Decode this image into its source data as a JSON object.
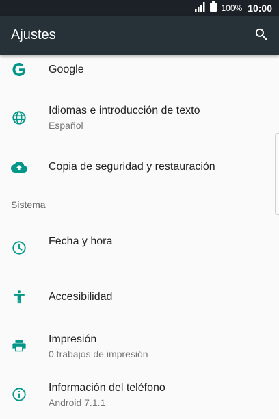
{
  "status_bar": {
    "battery_percent": "100%",
    "time": "10:00",
    "icons": [
      "signal-icon",
      "battery-icon"
    ]
  },
  "app_bar": {
    "title": "Ajustes",
    "search_icon": "search-icon"
  },
  "items": [
    {
      "title": "Google",
      "subtitle": "",
      "icon": "google-icon"
    },
    {
      "title": "Idiomas e introducción de texto",
      "subtitle": "Español",
      "icon": "globe-icon"
    },
    {
      "title": "Copia de seguridad y restauración",
      "subtitle": "",
      "icon": "cloud-upload-icon"
    }
  ],
  "section": {
    "label": "Sistema"
  },
  "system_items": [
    {
      "title": "Fecha y hora",
      "subtitle": "",
      "icon": "clock-icon"
    },
    {
      "title": "Accesibilidad",
      "subtitle": "",
      "icon": "accessibility-icon"
    },
    {
      "title": "Impresión",
      "subtitle": "0 trabajos de impresión",
      "icon": "printer-icon"
    },
    {
      "title": "Información del teléfono",
      "subtitle": "Android 7.1.1",
      "icon": "info-icon"
    }
  ],
  "colors": {
    "status_bar": "#1b2127",
    "app_bar": "#263238",
    "accent": "#009688",
    "background": "#fafafa",
    "primary_text": "#212121",
    "secondary_text": "#757575"
  }
}
